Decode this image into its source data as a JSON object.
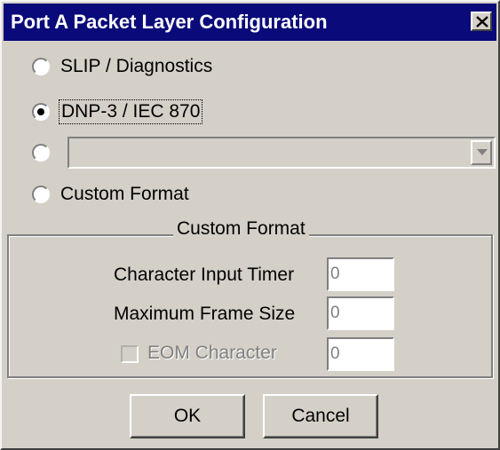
{
  "window": {
    "title": "Port A Packet Layer Configuration",
    "close_icon": "close-icon"
  },
  "protocol_options": [
    {
      "label": "SLIP / Diagnostics",
      "checked": false
    },
    {
      "label": "DNP-3 / IEC 870",
      "checked": true
    },
    {
      "label": "",
      "checked": false
    },
    {
      "label": "Custom Format",
      "checked": false
    }
  ],
  "protocol_combo": {
    "value": "",
    "enabled": false
  },
  "custom_format": {
    "group_title": "Custom Format",
    "char_input_timer_label": "Character Input Timer",
    "char_input_timer_value": "0",
    "max_frame_size_label": "Maximum Frame Size",
    "max_frame_size_value": "0",
    "eom_character_label": "EOM Character",
    "eom_character_value": "0",
    "eom_checked": false
  },
  "buttons": {
    "ok_label": "OK",
    "cancel_label": "Cancel"
  },
  "colors": {
    "title_bar": "#0a0a7a",
    "face": "#d4d0c8"
  }
}
